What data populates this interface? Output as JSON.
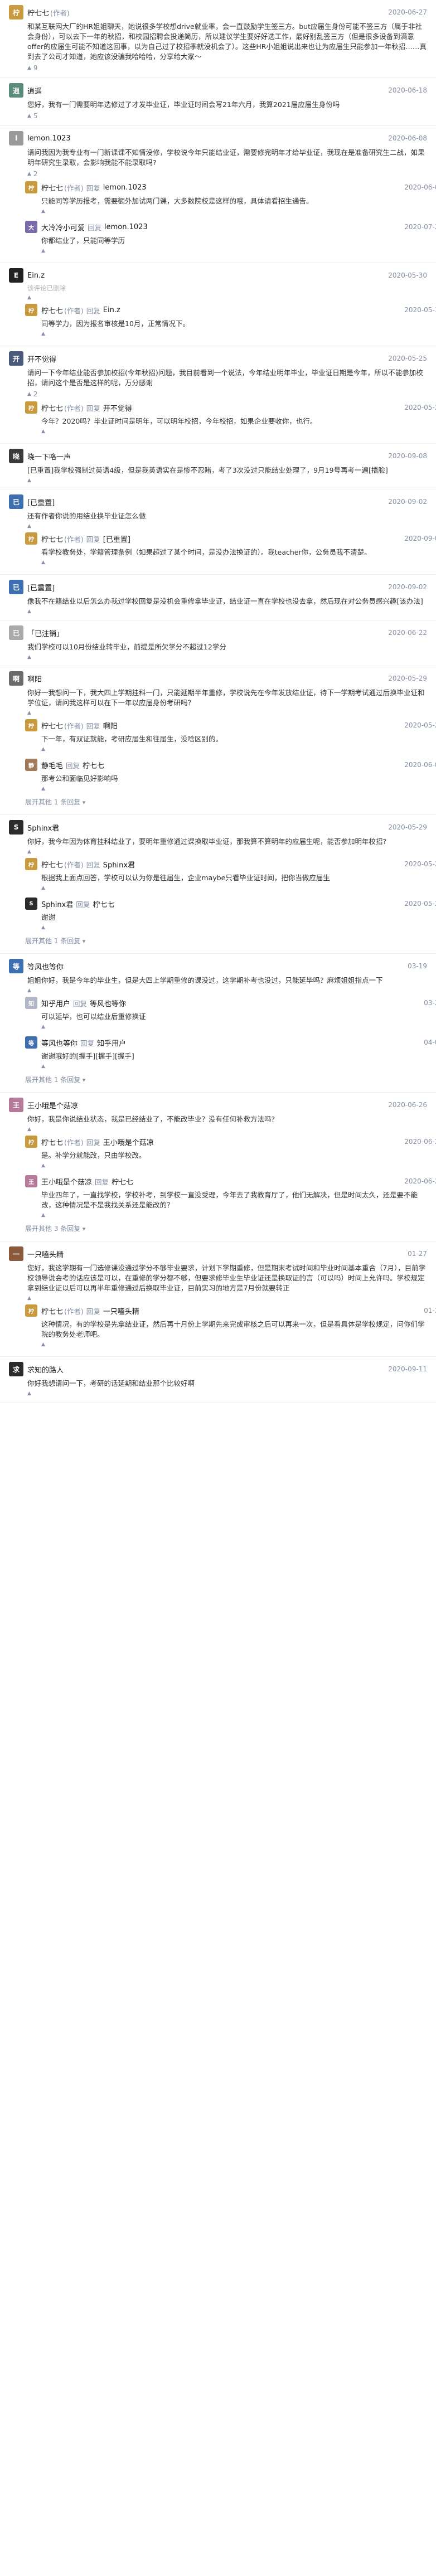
{
  "thread": [
    {
      "author": "柠七七",
      "tag": "(作者)",
      "date": "2020-06-27",
      "text": "和某互联网大厂的HR姐姐聊天，她说很多学校想drive就业率，会一直鼓励学生签三方。but应届生身份可能不签三方（属于非社会身份），可以去下一年的秋招，和校园招聘会投递简历，所以建议学生要好好选工作，最好别乱签三方（但是很多设备到满意offer的应届生可能不知道这回事，以为自己过了校招季就没机会了）。这些HR小姐姐说出来也让为应届生只能参加一年秋招……真到去了公司才知道，她应该没骗我哈哈哈，分享给大家～",
      "likes": "9",
      "color": "#c99a3e",
      "replies": []
    },
    {
      "author": "逍遥",
      "tag": "",
      "date": "2020-06-18",
      "text": "您好，我有一门需要明年选修过了才发毕业证，毕业证时间会写21年六月，我算2021届应届生身份吗",
      "likes": "5",
      "color": "#5b8c7a",
      "replies": []
    },
    {
      "author": "lemon.1023",
      "tag": "",
      "date": "2020-06-08",
      "text": "请问我因为我专业有一门新课课不知情没修，学校说今年只能结业证，需要修完明年才给毕业证，我现在是准备研究生二战，如果明年研究生录取，会影响我能不能录取吗?",
      "likes": "2",
      "color": "#9a9a9a",
      "replies": [
        {
          "author": "柠七七",
          "tag": "(作者)",
          "to": "lemon.1023",
          "date": "2020-06-08",
          "text": "只能同等学历报考，需要额外加试两门课，大多数院校是这样的哦，具体请看招生通告。",
          "likes": "",
          "color": "#c99a3e"
        },
        {
          "author": "大冷冷小可爱",
          "tag": "",
          "to": "lemon.1023",
          "date": "2020-07-29",
          "text": "你都结业了，只能同等学历",
          "likes": "",
          "color": "#7a6aa8"
        }
      ]
    },
    {
      "author": "Ein.z",
      "tag": "",
      "date": "2020-05-30",
      "text": "",
      "deleted": "该评论已删除",
      "likes": "",
      "color": "#222",
      "replies": [
        {
          "author": "柠七七",
          "tag": "(作者)",
          "to": "Ein.z",
          "date": "2020-05-30",
          "text": "同等学力，因为报名审核是10月，正常情况下。",
          "likes": "",
          "color": "#c99a3e"
        }
      ]
    },
    {
      "author": "开不觉得",
      "tag": "",
      "date": "2020-05-25",
      "text": "请问一下今年结业能否参加校招(今年秋招)问题，我目前看到一个说法，今年结业明年毕业，毕业证日期是今年，所以不能参加校招，请问这个是否是这样的呢，万分感谢",
      "likes": "2",
      "color": "#4a5a7a",
      "replies": [
        {
          "author": "柠七七",
          "tag": "(作者)",
          "to": "开不觉得",
          "date": "2020-05-26",
          "text": "今年？2020吗？毕业证时间是明年，可以明年校招，今年校招，如果企业要收你，也行。",
          "likes": "",
          "color": "#c99a3e"
        }
      ]
    },
    {
      "author": "晓一下咯一声",
      "tag": "",
      "date": "2020-09-08",
      "text": "[已重置]我学校强制过英语4级，但是我英语实在是惨不忍睹，考了3次没过只能结业处理了，9月19号再考一遍[捂脸]",
      "likes": "",
      "color": "#3a3a3a",
      "replies": []
    },
    {
      "author": "[已重置]",
      "tag": "",
      "date": "2020-09-02",
      "text": "还有作者你说的用结业换毕业证怎么做",
      "likes": "",
      "color": "#3e6fb0",
      "replies": [
        {
          "author": "柠七七",
          "tag": "(作者)",
          "to": "[已重置]",
          "date": "2020-09-04",
          "text": "看学校教务处，学籍管理条例（如果超过了某个时间，是没办法换证的）。我teacher你，公务员我不清楚。",
          "likes": "",
          "color": "#c99a3e"
        }
      ]
    },
    {
      "author": "[已重置]",
      "tag": "",
      "date": "2020-09-02",
      "text": "像我不在籍结业以后怎么办我过学校回复是没机会重修拿毕业证，结业证一直在学校也没去拿，然后现在对公务员感兴趣[该办法]",
      "likes": "",
      "color": "#3e6fb0",
      "replies": []
    },
    {
      "author": "「已注销」",
      "tag": "",
      "date": "2020-06-22",
      "text": "我们学校可以10月份结业转毕业，前提是所欠学分不超过12学分",
      "likes": "",
      "color": "#aaa",
      "replies": []
    },
    {
      "author": "啊阳",
      "tag": "",
      "date": "2020-05-29",
      "text": "你好一我想问一下，我大四上学期挂科一门，只能延期半年重修，学校说先在今年发放结业证，待下一学期考试通过后换毕业证和学位证，请问我这样可以在下一年以应届身份考研吗？",
      "likes": "",
      "color": "#6b6b6b",
      "replies": [
        {
          "author": "柠七七",
          "tag": "(作者)",
          "to": "啊阳",
          "date": "2020-05-29",
          "text": "下一年，有双证就能，考研应届生和往届生，没啥区别的。",
          "likes": "",
          "color": "#c99a3e"
        },
        {
          "author": "静毛毛",
          "tag": "",
          "to": "柠七七",
          "date": "2020-06-06",
          "text": "那考公和面临见好影响吗",
          "likes": "",
          "color": "#a07a5a"
        }
      ],
      "more": "展开其他 1 条回复"
    },
    {
      "author": "Sphinx君",
      "tag": "",
      "date": "2020-05-29",
      "text": "你好，我今年因为体育挂科结业了，要明年重修通过课换取毕业证，那我算不算明年的应届生呢，能否参加明年校招?",
      "likes": "",
      "color": "#2b2b2b",
      "replies": [
        {
          "author": "柠七七",
          "tag": "(作者)",
          "to": "Sphinx君",
          "date": "2020-05-29",
          "text": "根据我上面点回答，学校可以认为你是往届生，企业maybe只看毕业证时间，把你当做应届生",
          "likes": "",
          "color": "#c99a3e"
        },
        {
          "author": "Sphinx君",
          "tag": "",
          "to": "柠七七",
          "date": "2020-05-29",
          "text": "谢谢",
          "likes": "",
          "color": "#2b2b2b"
        }
      ],
      "more": "展开其他 1 条回复"
    },
    {
      "author": "等风也等你",
      "tag": "",
      "date": "03-19",
      "text": "姐姐你好，我是今年的毕业生，但是大四上学期重修的课没过，这学期补考也没过，只能延毕吗？麻烦姐姐指点一下",
      "likes": "",
      "color": "#3e6fb0",
      "replies": [
        {
          "author": "知乎用户",
          "tag": "",
          "to": "等风也等你",
          "date": "03-24",
          "text": "可以延毕，也可以结业后重修换证",
          "likes": "",
          "color": "#b0b8c8"
        },
        {
          "author": "等风也等你",
          "tag": "",
          "to": "知乎用户",
          "date": "04-02",
          "text": "谢谢哦好的[握手][握手][握手]",
          "likes": "",
          "color": "#3e6fb0"
        }
      ],
      "more": "展开其他 1 条回复"
    },
    {
      "author": "王小哦是个菇凉",
      "tag": "",
      "date": "2020-06-26",
      "text": "你好，我是你说结业状态，我是已经结业了，不能改毕业？没有任何补救方法吗?",
      "likes": "",
      "color": "#b57a9a",
      "replies": [
        {
          "author": "柠七七",
          "tag": "(作者)",
          "to": "王小哦是个菇凉",
          "date": "2020-06-26",
          "text": "是。补学分就能改，只由学校改。",
          "likes": "",
          "color": "#c99a3e"
        },
        {
          "author": "王小哦是个菇凉",
          "tag": "",
          "to": "柠七七",
          "date": "2020-06-28",
          "text": "毕业四年了，一直找学校，学校补考，到学校一直没受理，今年去了我教育厅了，他们无解决，但是时间太久，还是要不能改，这种情况是不是我找关系还是能改的？",
          "likes": "",
          "color": "#b57a9a"
        }
      ],
      "more": "展开其他 3 条回复"
    },
    {
      "author": "一只嗑头精",
      "tag": "",
      "date": "01-27",
      "text": "您好，我这学期有一门选修课没通过学分不够毕业要求，计划下学期重修，但是期末考试时间和毕业时间基本重合（7月），目前学校领导说会考的话应该是可以，在重修的学分都不够，但要求修毕业生毕业证还是换取证的言（可以吗）时间上允许吗。学校规定拿到结业证以后可以再半年重修通过后换取毕业证，目前实习的地方是7月份就要转正",
      "likes": "",
      "color": "#8a5a3a",
      "replies": [
        {
          "author": "柠七七",
          "tag": "(作者)",
          "to": "一只嗑头精",
          "date": "01-27",
          "text": "这种情况，有的学校是先拿结业证，然后再十月份上学期先来完成审核之后可以再来一次，但是看具体是学校规定，问你们学院的教务处老师吧。",
          "likes": "",
          "color": "#c99a3e"
        }
      ]
    },
    {
      "author": "求知的路人",
      "tag": "",
      "date": "2020-09-11",
      "text": "你好我想请问一下，考研的话延期和结业那个比较好啊",
      "likes": "",
      "color": "#2b2b2b",
      "replies": []
    }
  ],
  "labels": {
    "reply": "回复",
    "like_icon": "thumbs-up-icon",
    "more_icon": "chevron-down-icon"
  }
}
